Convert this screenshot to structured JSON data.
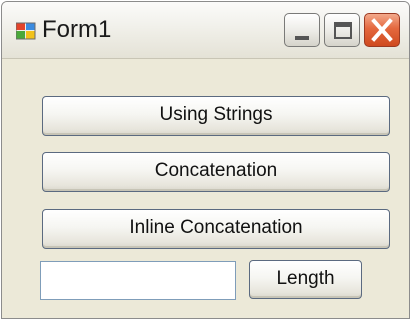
{
  "window": {
    "title": "Form1",
    "app_icon": "windows-form-icon",
    "caption_buttons": {
      "minimize_icon": "minimize-icon",
      "maximize_icon": "maximize-icon",
      "close_icon": "close-icon"
    }
  },
  "form": {
    "using_strings_label": "Using Strings",
    "concatenation_label": "Concatenation",
    "inline_concatenation_label": "Inline Concatenation",
    "text_value": "",
    "length_label": "Length"
  },
  "colors": {
    "window_background": "#ece9d8",
    "close_button": "#e4683e",
    "button_border": "#5b6a80",
    "textbox_border": "#7f9db9"
  }
}
